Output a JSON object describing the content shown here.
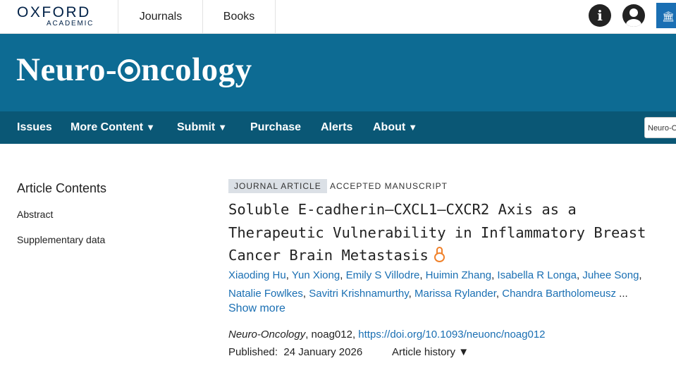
{
  "header": {
    "logo_main": "OXFORD",
    "logo_sub": "ACADEMIC",
    "nav": [
      "Journals",
      "Books"
    ],
    "icons": [
      "info-icon",
      "user-icon",
      "institution-icon"
    ]
  },
  "banner": {
    "journal_title_left": "Neuro-",
    "journal_title_right": "ncology",
    "color": "#0d6b93"
  },
  "menu": {
    "items": [
      "Issues",
      "More Content",
      "Submit",
      "Purchase",
      "Alerts",
      "About"
    ],
    "caret": "▼",
    "search_value": "Neuro-Oncology"
  },
  "contents": {
    "heading": "Article Contents",
    "links": [
      "Abstract",
      "Supplementary data"
    ]
  },
  "article": {
    "type_badge": "JOURNAL ARTICLE",
    "status": "ACCEPTED MANUSCRIPT",
    "title": "Soluble E-cadherin–CXCL1–CXCR2 Axis as a Therapeutic Vulnerability in Inflammatory Breast Cancer Brain Metastasis",
    "authors": [
      "Xiaoding Hu",
      "Yun Xiong",
      "Emily S Villodre",
      "Huimin Zhang",
      "Isabella R Longa",
      "Juhee Song",
      "Natalie Fowlkes",
      "Savitri Krishnamurthy",
      "Marissa Rylander",
      "Chandra Bartholomeusz"
    ],
    "authors_ellipsis": "...",
    "show_more": "Show more",
    "journal_name": "Neuro-Oncology",
    "article_id": ", noag012, ",
    "doi": "https://doi.org/10.1093/neuonc/noag012",
    "published_label": "Published:",
    "published_date": "24 January 2026",
    "history_label": "Article history",
    "history_caret": "▼"
  },
  "colors": {
    "link": "#1a6fb3",
    "menubar": "#0a5775",
    "open_access": "#f0812a"
  }
}
